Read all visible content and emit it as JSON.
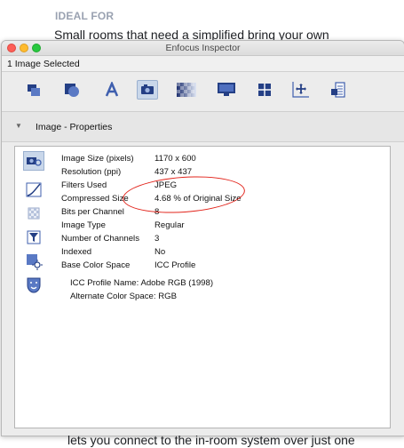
{
  "background": {
    "heading": "IDEAL FOR",
    "line_top": "Small rooms that need a simplified bring your own",
    "line_bottom": "lets you connect to the in-room system over just one"
  },
  "window": {
    "title": "Enfocus Inspector",
    "selection": "1 Image Selected",
    "section_title": "Image - Properties",
    "toolbar_icons": [
      "object-properties-icon",
      "shape-icon",
      "text-icon",
      "image-icon",
      "transparency-icon",
      "display-icon",
      "grid-icon",
      "position-icon",
      "document-icon"
    ],
    "side_icons": [
      "image-properties-icon",
      "curve-icon",
      "pattern-icon",
      "filter-icon",
      "brightness-icon",
      "mask-icon"
    ],
    "properties": [
      {
        "label": "Image Size (pixels)",
        "value": "1170 x 600"
      },
      {
        "label": "Resolution (ppi)",
        "value": "437 x 437"
      },
      {
        "label": "Filters Used",
        "value": "JPEG"
      },
      {
        "label": "Compressed Size",
        "value": "4.68 % of Original Size"
      },
      {
        "label": "Bits per Channel",
        "value": "8"
      },
      {
        "label": "Image Type",
        "value": "Regular"
      },
      {
        "label": "Number of Channels",
        "value": "3"
      },
      {
        "label": "Indexed",
        "value": "No"
      },
      {
        "label": "Base Color Space",
        "value": "ICC Profile"
      }
    ],
    "icc_profile_name": "ICC Profile Name: Adobe RGB (1998)",
    "alternate_color_space": "Alternate Color Space: RGB"
  },
  "colors": {
    "annotation_red": "#e2231a",
    "selected_blue": "#c9d7ea"
  }
}
